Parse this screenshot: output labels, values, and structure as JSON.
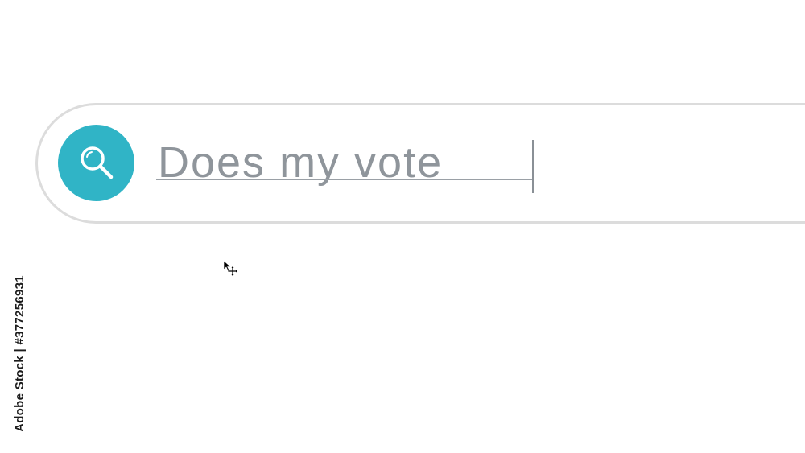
{
  "search": {
    "query_text": "Does my vote",
    "icon": "search-icon",
    "accent_color": "#30b4c6"
  },
  "pointer": {
    "icon": "move-cursor-icon"
  },
  "watermark": {
    "stock_id": "Adobe Stock | #377256931"
  }
}
